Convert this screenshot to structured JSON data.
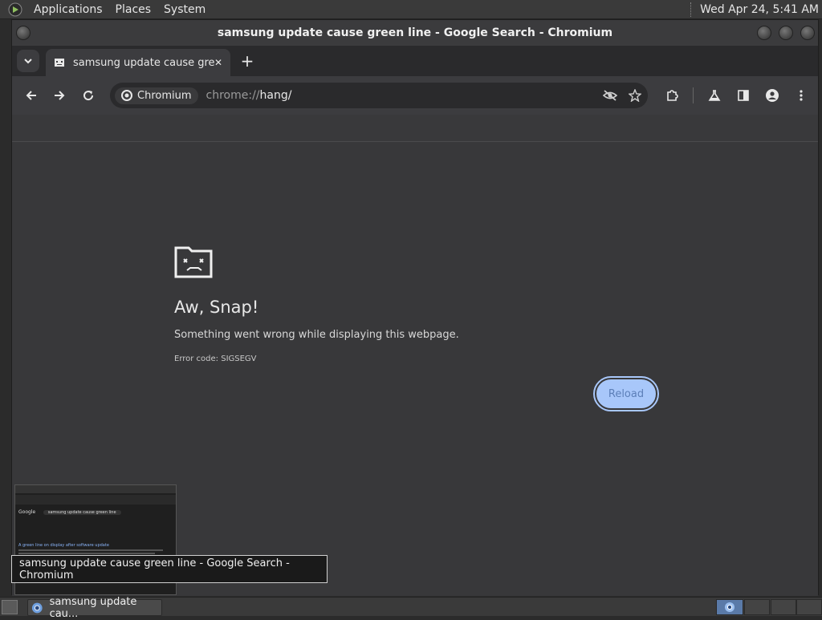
{
  "top_panel": {
    "menus": [
      "Applications",
      "Places",
      "System"
    ],
    "clock": "Wed Apr 24,  5:41 AM"
  },
  "window": {
    "title": "samsung update cause green line - Google Search - Chromium"
  },
  "tab": {
    "title": "samsung update cause green line - Google Search",
    "new_tab_symbol": "+",
    "close_symbol": "✕"
  },
  "omnibox": {
    "chip_label": "Chromium",
    "url_scheme": "chrome://",
    "url_path": "hang/"
  },
  "error_page": {
    "title": "Aw, Snap!",
    "description": "Something went wrong while displaying this webpage.",
    "error_code": "Error code: SIGSEGV",
    "reload_label": "Reload"
  },
  "taskbar": {
    "tooltip": "samsung update cause green line - Google Search - Chromium",
    "task_label": "samsung update cau..."
  },
  "preview": {
    "search_text": "samsung update cause green line",
    "result_title": "A green line on display after software update"
  },
  "colors": {
    "accent_button": "#a8c7fa",
    "page_bg": "#38383a"
  }
}
